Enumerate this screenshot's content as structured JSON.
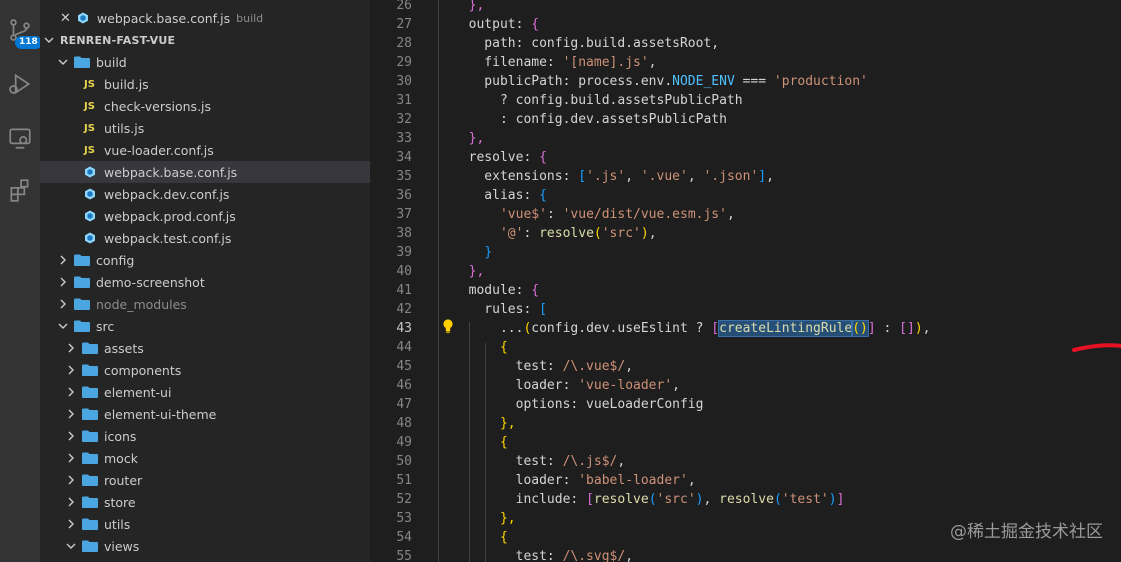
{
  "activity_bar": {
    "source_control_badge": "118",
    "icons": [
      "source-control-icon",
      "run-debug-icon",
      "remote-explorer-icon",
      "extensions-icon"
    ]
  },
  "sidebar": {
    "open_editor": {
      "file": "webpack.base.conf.js",
      "hint": "build"
    },
    "project": "RENREN-FAST-VUE",
    "tree": [
      {
        "label": "build",
        "kind": "folder",
        "expanded": true,
        "depth": 1
      },
      {
        "label": "build.js",
        "kind": "js",
        "depth": 2
      },
      {
        "label": "check-versions.js",
        "kind": "js",
        "depth": 2
      },
      {
        "label": "utils.js",
        "kind": "js",
        "depth": 2
      },
      {
        "label": "vue-loader.conf.js",
        "kind": "js",
        "depth": 2
      },
      {
        "label": "webpack.base.conf.js",
        "kind": "webpack",
        "depth": 2,
        "selected": true
      },
      {
        "label": "webpack.dev.conf.js",
        "kind": "webpack",
        "depth": 2
      },
      {
        "label": "webpack.prod.conf.js",
        "kind": "webpack",
        "depth": 2
      },
      {
        "label": "webpack.test.conf.js",
        "kind": "webpack",
        "depth": 2
      },
      {
        "label": "config",
        "kind": "folder",
        "expanded": false,
        "depth": 1
      },
      {
        "label": "demo-screenshot",
        "kind": "folder",
        "expanded": false,
        "depth": 1
      },
      {
        "label": "node_modules",
        "kind": "folder",
        "expanded": false,
        "depth": 1,
        "dim": true
      },
      {
        "label": "src",
        "kind": "folder",
        "expanded": true,
        "depth": 1
      },
      {
        "label": "assets",
        "kind": "folder",
        "expanded": false,
        "depth": 2
      },
      {
        "label": "components",
        "kind": "folder",
        "expanded": false,
        "depth": 2
      },
      {
        "label": "element-ui",
        "kind": "folder",
        "expanded": false,
        "depth": 2
      },
      {
        "label": "element-ui-theme",
        "kind": "folder",
        "expanded": false,
        "depth": 2
      },
      {
        "label": "icons",
        "kind": "folder",
        "expanded": false,
        "depth": 2
      },
      {
        "label": "mock",
        "kind": "folder",
        "expanded": false,
        "depth": 2
      },
      {
        "label": "router",
        "kind": "folder",
        "expanded": false,
        "depth": 2
      },
      {
        "label": "store",
        "kind": "folder",
        "expanded": false,
        "depth": 2
      },
      {
        "label": "utils",
        "kind": "folder",
        "expanded": false,
        "depth": 2
      },
      {
        "label": "views",
        "kind": "folder",
        "expanded": true,
        "depth": 2
      }
    ]
  },
  "editor": {
    "active_line": "43",
    "lines": [
      {
        "n": "26",
        "t": [
          [
            "  ",
            ""
          ],
          [
            "},",
            "b2"
          ]
        ]
      },
      {
        "n": "27",
        "t": [
          [
            "  output: ",
            ""
          ],
          [
            "{",
            "b2"
          ]
        ]
      },
      {
        "n": "28",
        "t": [
          [
            "    path: config.build.assetsRoot,",
            ""
          ]
        ]
      },
      {
        "n": "29",
        "t": [
          [
            "    filename: ",
            ""
          ],
          [
            "'[name].js'",
            "s"
          ],
          [
            ",",
            ""
          ]
        ]
      },
      {
        "n": "30",
        "t": [
          [
            "    publicPath: process.env.",
            ""
          ],
          [
            "NODE_ENV",
            "c"
          ],
          [
            " === ",
            ""
          ],
          [
            "'production'",
            "s"
          ]
        ]
      },
      {
        "n": "31",
        "t": [
          [
            "      ? config.build.assetsPublicPath",
            ""
          ]
        ]
      },
      {
        "n": "32",
        "t": [
          [
            "      : config.dev.assetsPublicPath",
            ""
          ]
        ]
      },
      {
        "n": "33",
        "t": [
          [
            "  ",
            ""
          ],
          [
            "},",
            "b2"
          ]
        ]
      },
      {
        "n": "34",
        "t": [
          [
            "  resolve: ",
            ""
          ],
          [
            "{",
            "b2"
          ]
        ]
      },
      {
        "n": "35",
        "t": [
          [
            "    extensions: ",
            ""
          ],
          [
            "[",
            "b3"
          ],
          [
            "'.js'",
            "s"
          ],
          [
            ", ",
            ""
          ],
          [
            "'.vue'",
            "s"
          ],
          [
            ", ",
            ""
          ],
          [
            "'.json'",
            "s"
          ],
          [
            "]",
            "b3"
          ],
          [
            ",",
            ""
          ]
        ]
      },
      {
        "n": "36",
        "t": [
          [
            "    alias: ",
            ""
          ],
          [
            "{",
            "b3"
          ]
        ]
      },
      {
        "n": "37",
        "t": [
          [
            "      ",
            ""
          ],
          [
            "'vue$'",
            "s"
          ],
          [
            ": ",
            ""
          ],
          [
            "'vue/dist/vue.esm.js'",
            "s"
          ],
          [
            ",",
            ""
          ]
        ]
      },
      {
        "n": "38",
        "t": [
          [
            "      ",
            ""
          ],
          [
            "'@'",
            "s"
          ],
          [
            ": ",
            ""
          ],
          [
            "resolve",
            "f"
          ],
          [
            "(",
            "b1"
          ],
          [
            "'src'",
            "s"
          ],
          [
            ")",
            "b1"
          ],
          [
            ",",
            ""
          ]
        ]
      },
      {
        "n": "39",
        "t": [
          [
            "    ",
            ""
          ],
          [
            "}",
            "b3"
          ]
        ]
      },
      {
        "n": "40",
        "t": [
          [
            "  ",
            ""
          ],
          [
            "},",
            "b2"
          ]
        ]
      },
      {
        "n": "41",
        "t": [
          [
            "  module: ",
            ""
          ],
          [
            "{",
            "b2"
          ]
        ]
      },
      {
        "n": "42",
        "t": [
          [
            "    rules: ",
            ""
          ],
          [
            "[",
            "b3"
          ]
        ]
      },
      {
        "n": "43",
        "t": [
          [
            "      ...",
            ""
          ],
          [
            "(",
            "b1"
          ],
          [
            "config.dev.useEslint ? ",
            ""
          ],
          [
            "[",
            "b2"
          ],
          [
            "createLintingRule",
            "fh"
          ],
          [
            "()",
            "bh"
          ],
          [
            "]",
            "b2"
          ],
          [
            " : ",
            ""
          ],
          [
            "[]",
            "b2"
          ],
          [
            ")",
            "b1"
          ],
          [
            ",",
            ""
          ]
        ]
      },
      {
        "n": "44",
        "t": [
          [
            "      ",
            ""
          ],
          [
            "{",
            "b1"
          ]
        ]
      },
      {
        "n": "45",
        "t": [
          [
            "        test: ",
            ""
          ],
          [
            "/\\.vue$/",
            "s"
          ],
          [
            ",",
            ""
          ]
        ]
      },
      {
        "n": "46",
        "t": [
          [
            "        loader: ",
            ""
          ],
          [
            "'vue-loader'",
            "s"
          ],
          [
            ",",
            ""
          ]
        ]
      },
      {
        "n": "47",
        "t": [
          [
            "        options: vueLoaderConfig",
            ""
          ]
        ]
      },
      {
        "n": "48",
        "t": [
          [
            "      ",
            ""
          ],
          [
            "},",
            "b1"
          ]
        ]
      },
      {
        "n": "49",
        "t": [
          [
            "      ",
            ""
          ],
          [
            "{",
            "b1"
          ]
        ]
      },
      {
        "n": "50",
        "t": [
          [
            "        test: ",
            ""
          ],
          [
            "/\\.js$/",
            "s"
          ],
          [
            ",",
            ""
          ]
        ]
      },
      {
        "n": "51",
        "t": [
          [
            "        loader: ",
            ""
          ],
          [
            "'babel-loader'",
            "s"
          ],
          [
            ",",
            ""
          ]
        ]
      },
      {
        "n": "52",
        "t": [
          [
            "        include: ",
            ""
          ],
          [
            "[",
            "b2"
          ],
          [
            "resolve",
            "f"
          ],
          [
            "(",
            "b3"
          ],
          [
            "'src'",
            "s"
          ],
          [
            ")",
            "b3"
          ],
          [
            ", ",
            ""
          ],
          [
            "resolve",
            "f"
          ],
          [
            "(",
            "b3"
          ],
          [
            "'test'",
            "s"
          ],
          [
            ")",
            "b3"
          ],
          [
            "]",
            "b2"
          ]
        ]
      },
      {
        "n": "53",
        "t": [
          [
            "      ",
            ""
          ],
          [
            "},",
            "b1"
          ]
        ]
      },
      {
        "n": "54",
        "t": [
          [
            "      ",
            ""
          ],
          [
            "{",
            "b1"
          ]
        ]
      },
      {
        "n": "55",
        "t": [
          [
            "        test: ",
            ""
          ],
          [
            "/\\.svg$/",
            "s"
          ],
          [
            ",",
            ""
          ]
        ]
      }
    ]
  },
  "watermark": "@稀土掘金技术社区",
  "colors": {
    "activity": "#333333",
    "sidebar": "#252526",
    "editor": "#1e1e1e",
    "selection": "#264f78",
    "badge": "#0078d4"
  }
}
